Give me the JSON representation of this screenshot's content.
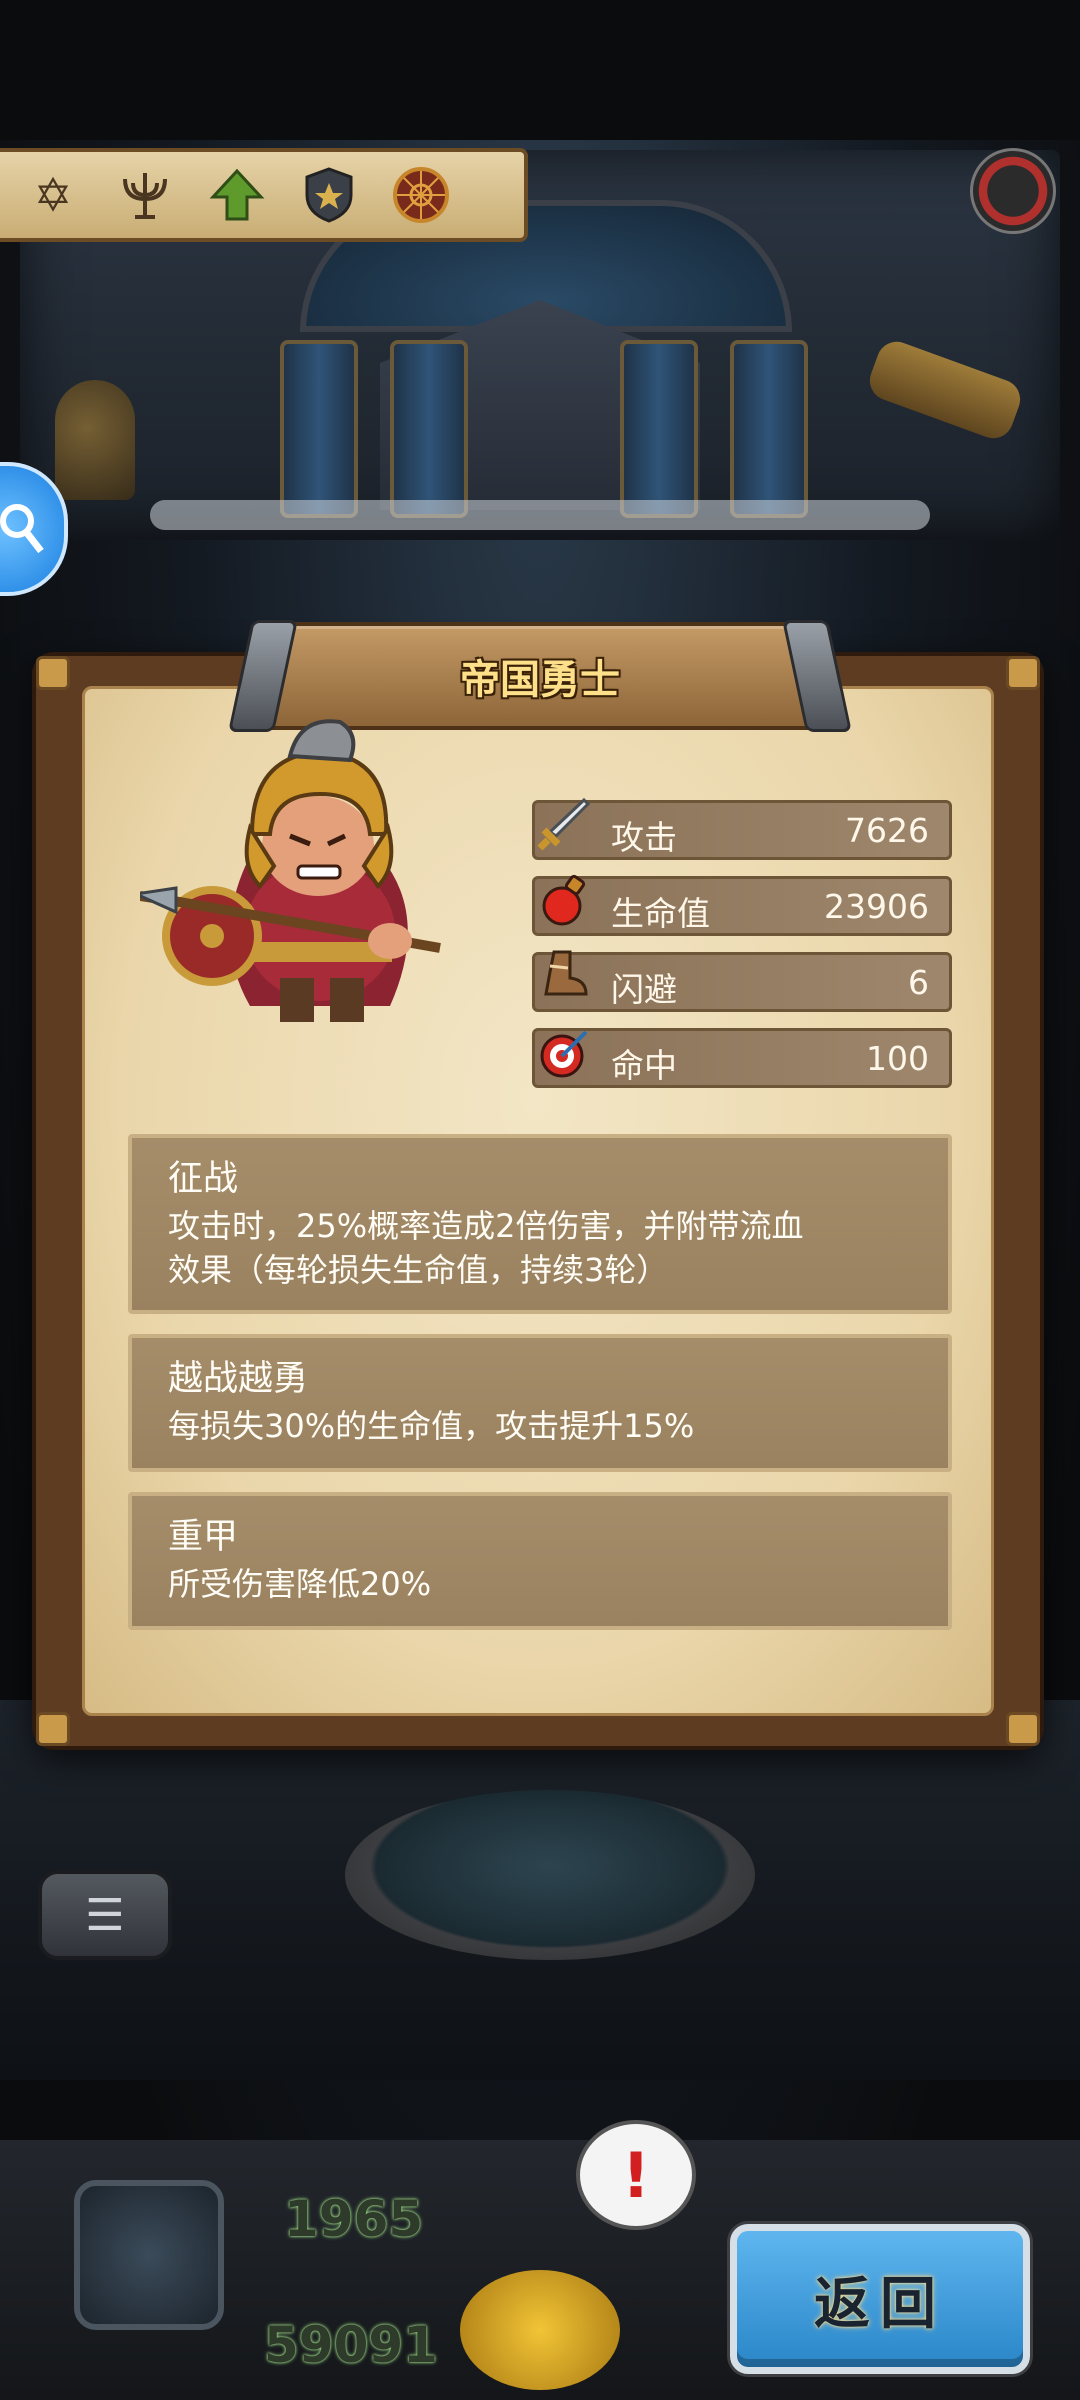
{
  "toolbar": {
    "icons": [
      "star-of-david-icon",
      "menorah-icon",
      "up-arrow-icon",
      "shield-icon",
      "compass-wheel-icon"
    ]
  },
  "hero": {
    "name": "帝国勇士"
  },
  "stats": [
    {
      "icon": "sword-icon",
      "label": "攻击",
      "value": "7626"
    },
    {
      "icon": "potion-icon",
      "label": "生命值",
      "value": "23906"
    },
    {
      "icon": "boot-icon",
      "label": "闪避",
      "value": "6"
    },
    {
      "icon": "target-icon",
      "label": "命中",
      "value": "100"
    }
  ],
  "skills": [
    {
      "name": "征战",
      "desc": "攻击时，25%概率造成2倍伤害，并附带流血\n效果（每轮损失生命值，持续3轮）"
    },
    {
      "name": "越战越勇",
      "desc": "每损失30%的生命值，攻击提升15%"
    },
    {
      "name": "重甲",
      "desc": "所受伤害降低20%"
    }
  ],
  "bottom": {
    "attack_value": "1965",
    "hp_value": "59091",
    "alert_symbol": "!",
    "return_label": "返回"
  },
  "colors": {
    "panel_bg": "#ead6aa",
    "stat_bar": "#8b7258",
    "skill_box": "#a58d6a",
    "title_text": "#ffe08a",
    "return_button": "#3f9ee0"
  }
}
